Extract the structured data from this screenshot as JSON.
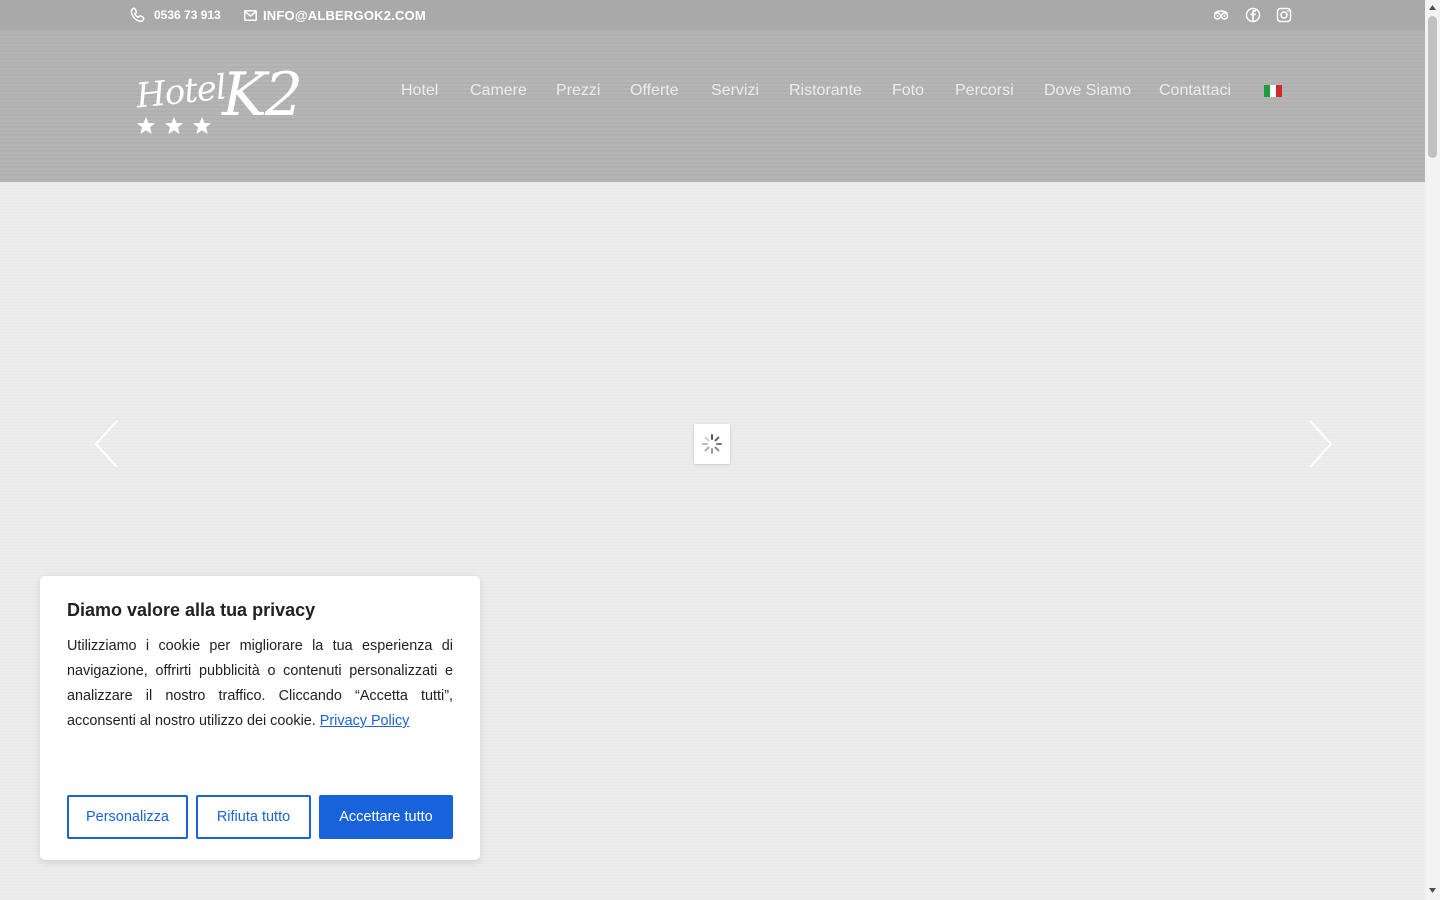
{
  "topbar": {
    "phone": "0536 73 913",
    "email": "INFO@ALBERGOK2.COM",
    "social_icons": [
      "tripadvisor-icon",
      "facebook-icon",
      "instagram-icon"
    ]
  },
  "header": {
    "logo_hotel": "Hotel",
    "logo_k2": "K2",
    "nav": [
      {
        "label": "Hotel"
      },
      {
        "label": "Camere"
      },
      {
        "label": "Prezzi"
      },
      {
        "label": "Offerte"
      },
      {
        "label": "Servizi"
      },
      {
        "label": "Ristorante"
      },
      {
        "label": "Foto"
      },
      {
        "label": "Percorsi"
      },
      {
        "label": "Dove Siamo"
      },
      {
        "label": "Contattaci"
      }
    ],
    "language_flag": "italy-flag-icon"
  },
  "slider": {
    "prev_icon": "chevron-left-icon",
    "next_icon": "chevron-right-icon",
    "loading_icon": "spinner-icon"
  },
  "cookie": {
    "title": "Diamo valore alla tua privacy",
    "text": "Utilizziamo i cookie per migliorare la tua esperienza di navigazione, offrirti pubblicità o contenuti personalizzati e analizzare il nostro traffico. Cliccando “Accetta tutti”, acconsenti al nostro utilizzo dei cookie.",
    "link": "Privacy Policy",
    "btn_customize": "Personalizza",
    "btn_reject": "Rifiuta tutto",
    "btn_accept": "Accettare tutto"
  },
  "colors": {
    "primary": "#1863dc",
    "topbar": "#a9a9a9",
    "header": "#b3b3b3",
    "background": "#ececec"
  }
}
